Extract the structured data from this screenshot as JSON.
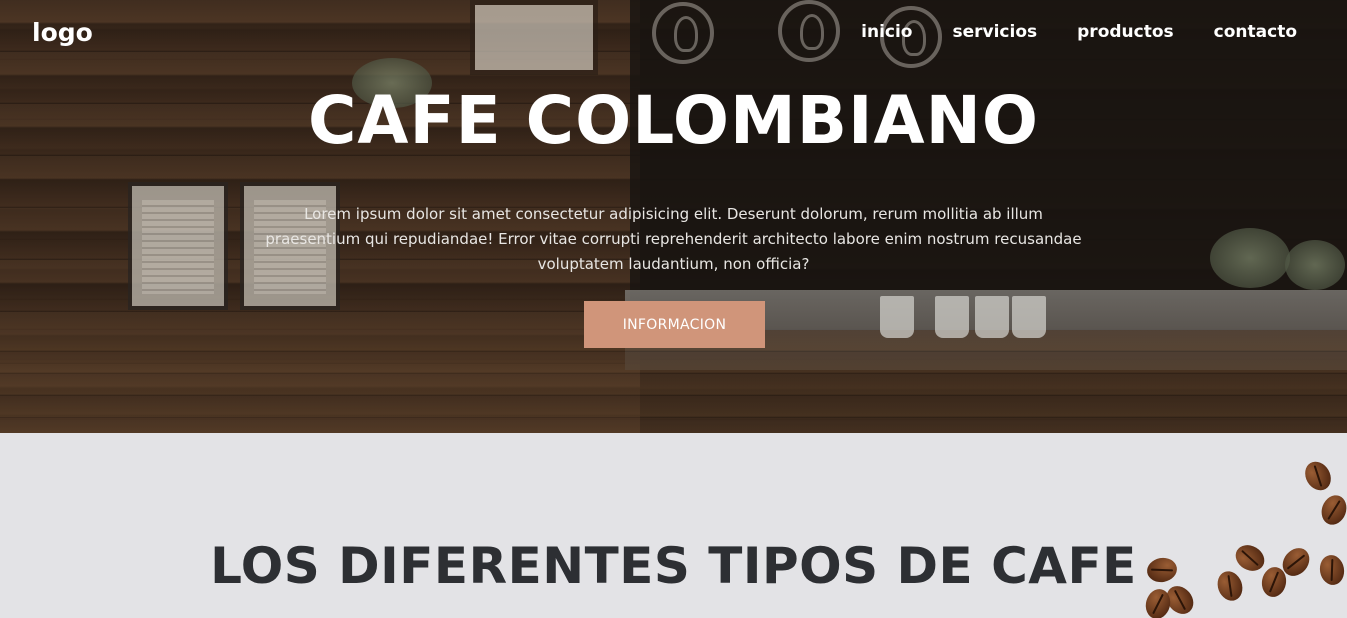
{
  "header": {
    "logo": "logo",
    "nav": [
      "inicio",
      "servicios",
      "productos",
      "contacto"
    ]
  },
  "hero": {
    "title": "CAFE COLOMBIANO",
    "text": "Lorem ipsum dolor sit amet consectetur adipisicing elit. Deserunt dolorum, rerum mollitia ab illum praesentium qui repudiandae! Error vitae corrupti reprehenderit architecto labore enim nostrum recusandae voluptatem laudantium, non officia?",
    "button_label": "INFORMACION"
  },
  "section": {
    "title": "LOS DIFERENTES TIPOS DE CAFE"
  },
  "colors": {
    "button": "#d0957a",
    "section_bg": "#e3e3e6",
    "section_title": "#2d2f33"
  }
}
